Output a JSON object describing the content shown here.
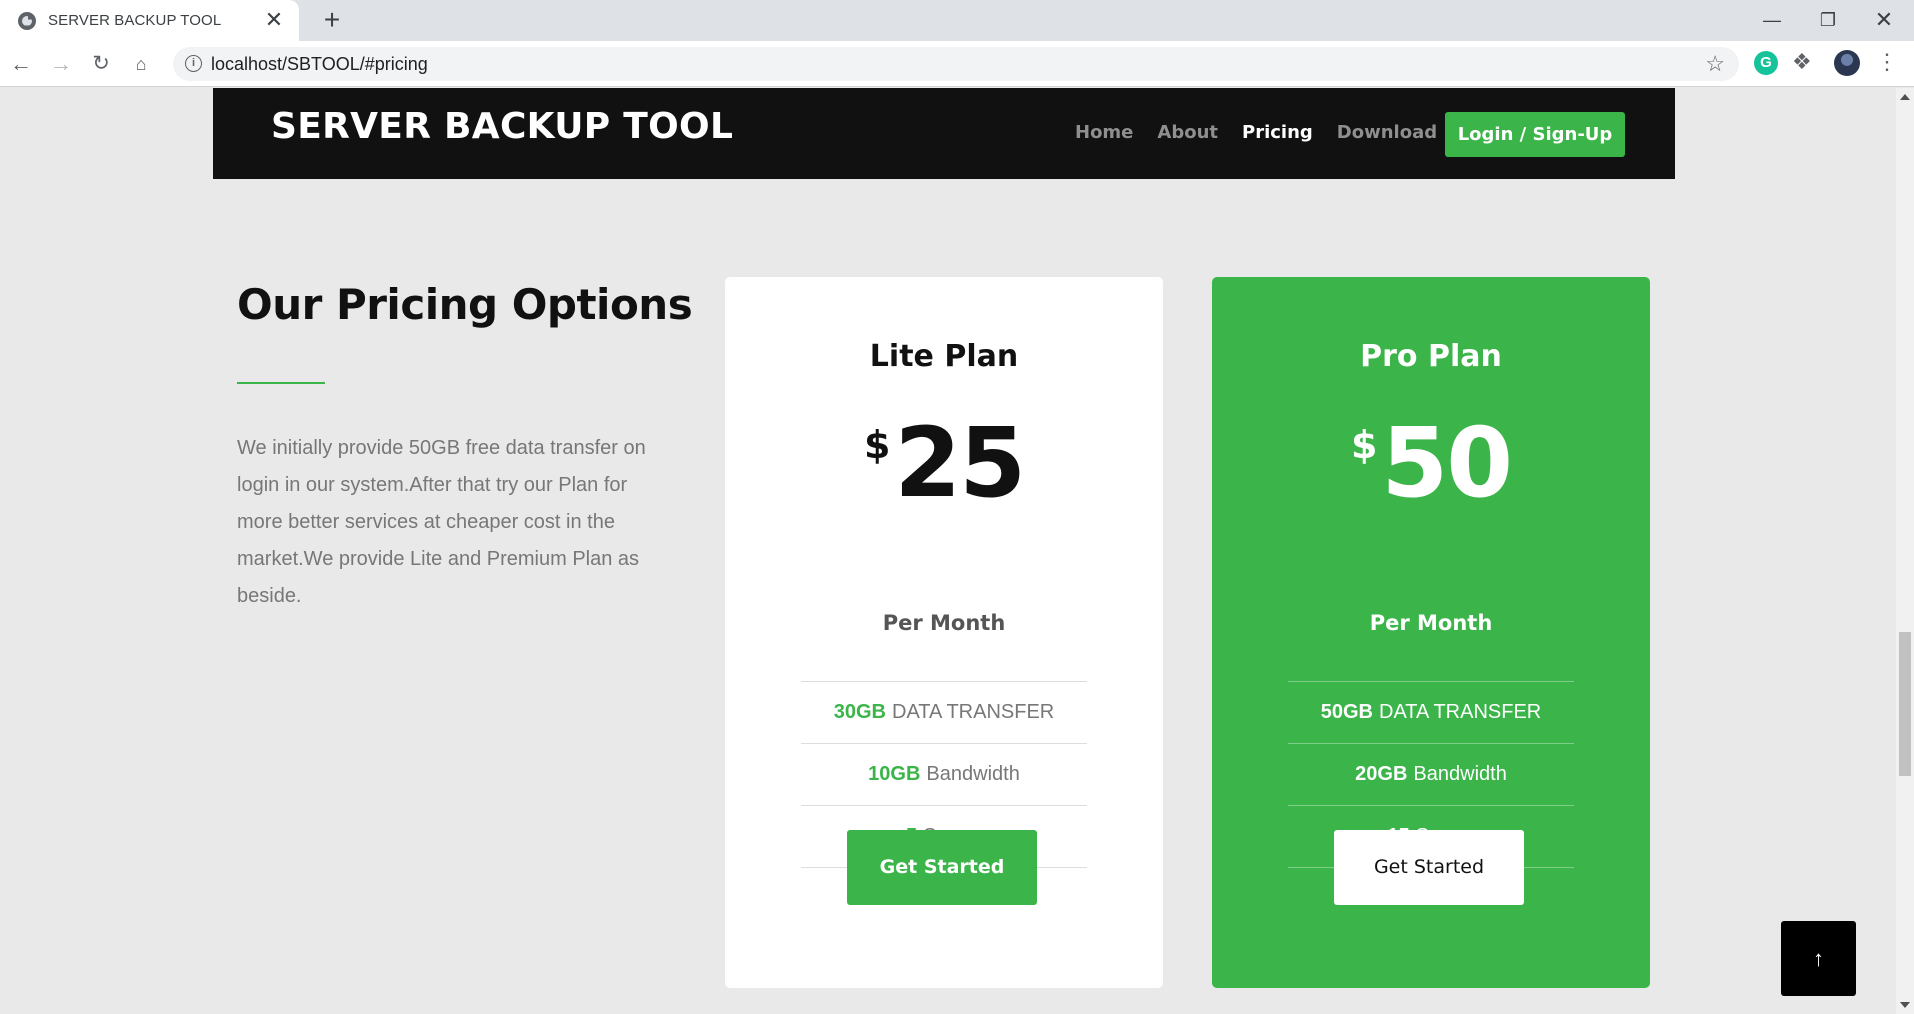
{
  "browser": {
    "tab_title": "SERVER BACKUP TOOL",
    "tab_close": "✕",
    "new_tab": "+",
    "url": "localhost/SBTOOL/#pricing",
    "icons": [
      "globe-icon",
      "close-icon",
      "plus-icon",
      "back-arrow-icon",
      "forward-arrow-icon",
      "reload-icon",
      "home-icon",
      "info-icon",
      "star-icon",
      "grammarly-icon",
      "puzzle-icon",
      "avatar",
      "menu-dots-icon"
    ],
    "window_controls": {
      "minimize": "—",
      "maximize": "❐",
      "close": "✕"
    }
  },
  "site": {
    "brand": "SERVER BACKUP TOOL",
    "nav": [
      "Home",
      "About",
      "Pricing",
      "Download"
    ],
    "active_nav": "Pricing",
    "login_label": "Login / Sign-Up",
    "accent_color": "#3bb54a",
    "header_color": "#111111"
  },
  "intro": {
    "title": "Our Pricing Options",
    "text": "We initially provide 50GB free data transfer on login in our system.After that try our Plan for more better services at cheaper cost in the market.We provide Lite and Premium Plan as beside."
  },
  "plans": [
    {
      "name": "Lite Plan",
      "currency": "$",
      "price": "25",
      "period": "Per Month",
      "features": [
        {
          "value": "30GB",
          "label": "DATA TRANSFER"
        },
        {
          "value": "10GB",
          "label": "Bandwidth"
        },
        {
          "value": "5",
          "label": "Server"
        }
      ],
      "cta": "Get Started"
    },
    {
      "name": "Pro Plan",
      "currency": "$",
      "price": "50",
      "period": "Per Month",
      "features": [
        {
          "value": "50GB",
          "label": "DATA TRANSFER"
        },
        {
          "value": "20GB",
          "label": "Bandwidth"
        },
        {
          "value": "15",
          "label": "Server"
        }
      ],
      "cta": "Get Started"
    }
  ],
  "back_to_top": "↑"
}
